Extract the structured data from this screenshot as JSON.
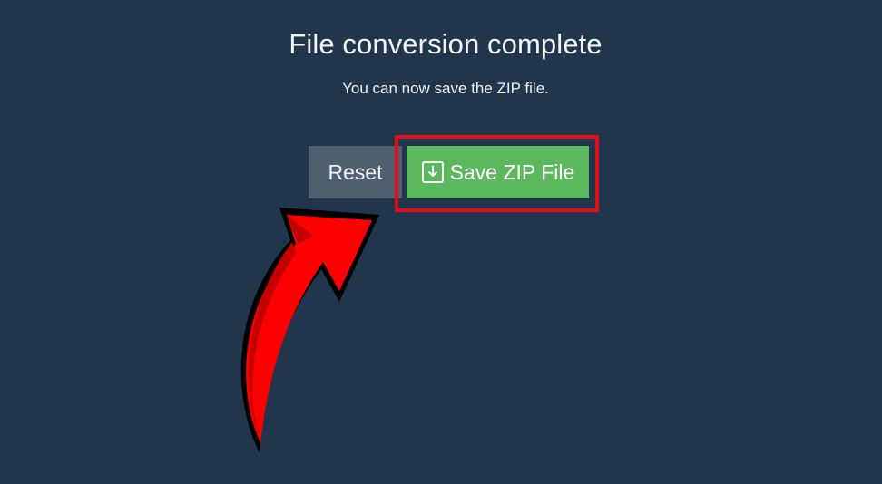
{
  "dialog": {
    "title": "File conversion complete",
    "subtitle": "You can now save the ZIP file."
  },
  "buttons": {
    "reset_label": "Reset",
    "save_label": "Save ZIP File",
    "save_icon": "download-icon"
  },
  "annotation": {
    "highlight_color": "#e0101a",
    "arrow_color": "#ff0000"
  },
  "colors": {
    "background": "#21364c",
    "reset_button": "#4e5f70",
    "save_button": "#5cb85c"
  }
}
